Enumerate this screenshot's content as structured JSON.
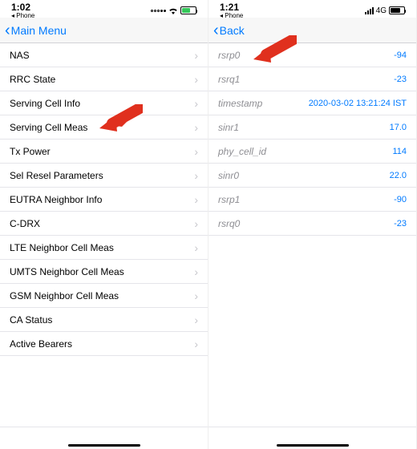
{
  "left": {
    "status": {
      "time": "1:02",
      "sub": "◂ Phone"
    },
    "nav": {
      "back": "Main Menu"
    },
    "rows": [
      {
        "label": "NAS"
      },
      {
        "label": "RRC State"
      },
      {
        "label": "Serving Cell Info"
      },
      {
        "label": "Serving Cell Meas"
      },
      {
        "label": "Tx Power"
      },
      {
        "label": "Sel Resel Parameters"
      },
      {
        "label": "EUTRA Neighbor Info"
      },
      {
        "label": "C-DRX"
      },
      {
        "label": "LTE Neighbor Cell Meas"
      },
      {
        "label": "UMTS Neighbor Cell Meas"
      },
      {
        "label": "GSM Neighbor Cell Meas"
      },
      {
        "label": "CA Status"
      },
      {
        "label": "Active Bearers"
      }
    ]
  },
  "right": {
    "status": {
      "time": "1:21",
      "sub": "◂ Phone",
      "net": "4G"
    },
    "nav": {
      "back": "Back"
    },
    "rows": [
      {
        "label": "rsrp0",
        "value": "-94"
      },
      {
        "label": "rsrq1",
        "value": "-23"
      },
      {
        "label": "timestamp",
        "value": "2020-03-02 13:21:24 IST"
      },
      {
        "label": "sinr1",
        "value": "17.0"
      },
      {
        "label": "phy_cell_id",
        "value": "114"
      },
      {
        "label": "sinr0",
        "value": "22.0"
      },
      {
        "label": "rsrp1",
        "value": "-90"
      },
      {
        "label": "rsrq0",
        "value": "-23"
      }
    ]
  }
}
